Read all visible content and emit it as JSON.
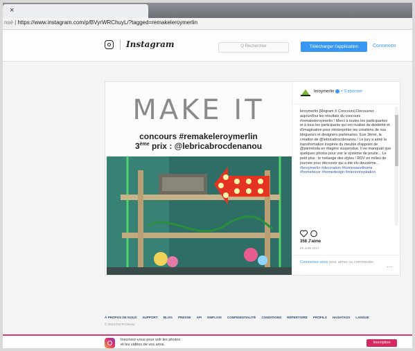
{
  "browser": {
    "tab_close": "×",
    "address_prefix": "nsé",
    "address_url": "https://www.instagram.com/p/BVyrWRChuyL/?tagged=remakeleroymerlin"
  },
  "header": {
    "brand": "Instagram",
    "search_placeholder": "Q Rechercher",
    "download_button": "Télécharger l'application",
    "login_link": "Connexion"
  },
  "post": {
    "image_title": "MAKE IT",
    "image_line1": "concours #remakeleroymerlin",
    "image_line2_pre": "3",
    "image_line2_sup": "ème",
    "image_line2_post": " prix : @lebricabrocdenanou",
    "username": "leroymerlin",
    "follow_label": "• S'abonner",
    "caption_intro": "leroymerlin [Regram X Concours] Découvrez aujourd'hui les résultats du concours #remakeleroymerlin ! Merci à toutes les participantes et à tous les participants qui ont rivalisé de dextérité et d'imagination pour réinterpréter les créations de nos blogueurs et designers partenaires. Eue 3ème, la création de @lebricabrocdenanou ! Le jury a aimé la transformation inspirée du meuble d'appoint de @pierreloila en étagère suspendue. Il ne manquait que quelques photos pour voir le système de poulie... Le petit plus : le mélange des styles ! RDV en milieu de journée pour découvrir qui a été élu deuxième...",
    "hashtags": "#leroymerlin #decoration #homesweethome #homedecor #homedesign #interiorinspiration",
    "likes": "358 J'aime",
    "date": "26 JUIN 2017",
    "comment_link": "Connectez-vous",
    "comment_text": " pour aimer ou commenter.",
    "more": "···"
  },
  "footer": {
    "links": [
      "À PROPOS DE NOUS",
      "SUPPORT",
      "BLOG",
      "PRESSE",
      "API",
      "EMPLOIS",
      "CONFIDENTIALITÉ",
      "CONDITIONS",
      "RÉPERTOIRE",
      "PROFILS",
      "HASHTAGS",
      "LANGUE"
    ],
    "copyright": "© 2018 INSTAGRAM"
  },
  "promo": {
    "line1": "Inscrivez-vous pour voir les photos",
    "line2": "et les vidéos de vos amis.",
    "signup_button": "Inscription"
  }
}
